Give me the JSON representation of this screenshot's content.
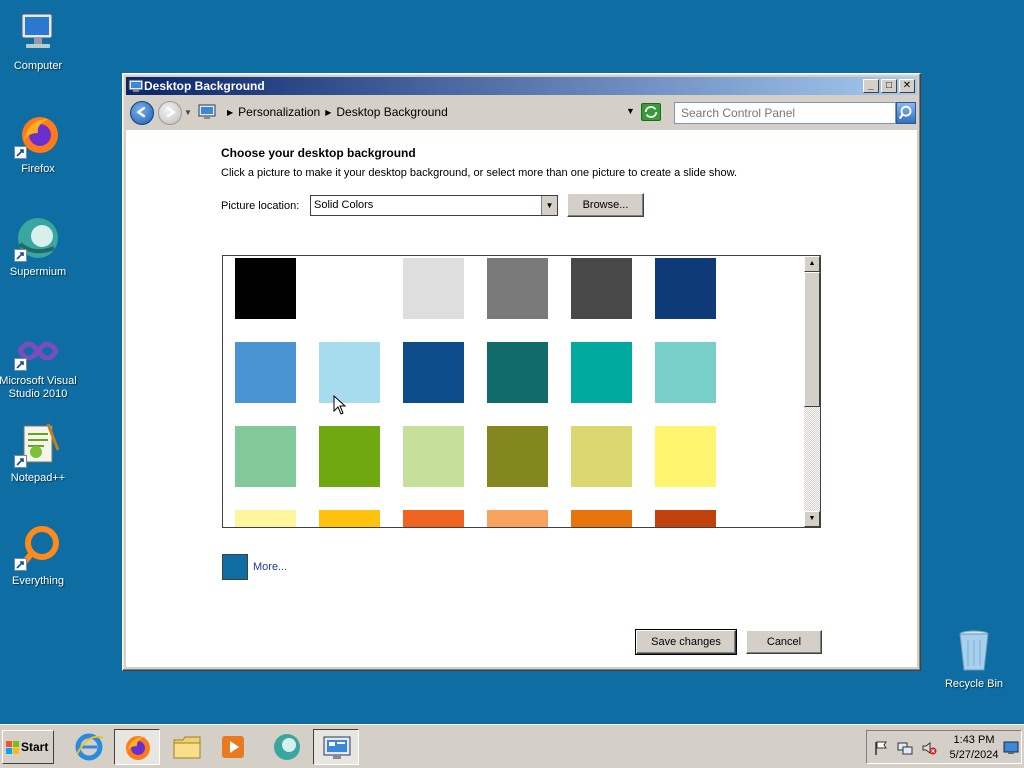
{
  "desktop": {
    "background_color": "#0e6ea3",
    "icons": [
      {
        "label": "Computer",
        "icon": "computer-icon"
      },
      {
        "label": "Firefox",
        "icon": "firefox-icon"
      },
      {
        "label": "Supermium",
        "icon": "supermium-icon"
      },
      {
        "label": "Microsoft Visual Studio 2010",
        "icon": "visual-studio-icon"
      },
      {
        "label": "Notepad++",
        "icon": "notepadpp-icon"
      },
      {
        "label": "Everything",
        "icon": "everything-icon"
      },
      {
        "label": "Recycle Bin",
        "icon": "recycle-bin-icon"
      }
    ]
  },
  "window": {
    "title": "Desktop Background",
    "controls": {
      "minimize": "_",
      "maximize": "□",
      "close": "✕"
    },
    "breadcrumb": [
      "Personalization",
      "Desktop Background"
    ],
    "search_placeholder": "Search Control Panel",
    "heading": "Choose your desktop background",
    "subtext": "Click a picture to make it your desktop background, or select more than one picture to create a slide show.",
    "picture_location_label": "Picture location:",
    "picture_location_value": "Solid Colors",
    "browse_label": "Browse...",
    "more_label": "More...",
    "more_color": "#0e6ea3",
    "save_label": "Save changes",
    "cancel_label": "Cancel",
    "swatch_rows": [
      [
        "#000000",
        "#ffffff",
        "#dedede",
        "#7a7a7a",
        "#484848",
        "#0f3a78"
      ],
      [
        "#4a94d4",
        "#a6dcee",
        "#0d4d8c",
        "#106b6a",
        "#00a99d",
        "#78cfca"
      ],
      [
        "#82c99a",
        "#6fa810",
        "#c6e09c",
        "#83881e",
        "#dcd870",
        "#fff56e"
      ],
      [
        "#fff59c",
        "#ffc20e",
        "#ef6421",
        "#f7a25e",
        "#e8740e",
        "#c0420c"
      ]
    ]
  },
  "taskbar": {
    "start_label": "Start",
    "apps": [
      {
        "name": "internet-explorer-icon",
        "active": false
      },
      {
        "name": "firefox-icon",
        "active": false
      },
      {
        "name": "file-explorer-icon",
        "active": false
      },
      {
        "name": "media-player-icon",
        "active": false
      },
      {
        "name": "supermium-icon",
        "active": false
      },
      {
        "name": "control-panel-icon",
        "active": true
      }
    ],
    "tray_icons": [
      "flag-icon",
      "network-icon",
      "volume-muted-icon"
    ],
    "time": "1:43 PM",
    "date": "5/27/2024"
  }
}
